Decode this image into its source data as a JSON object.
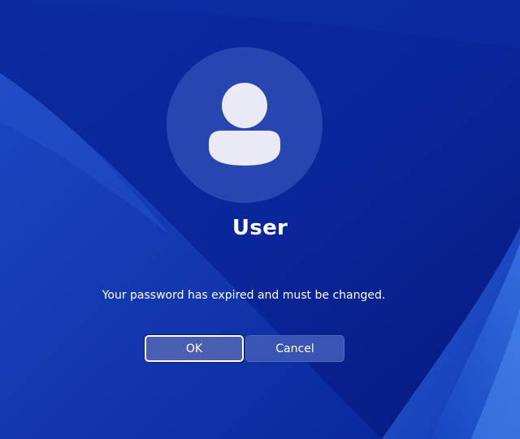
{
  "user": {
    "name": "User",
    "avatar_icon": "person-icon"
  },
  "dialog": {
    "message": "Your password has expired and must be changed.",
    "ok_label": "OK",
    "cancel_label": "Cancel"
  },
  "colors": {
    "background": "#0a2a9c",
    "button_ok": "#4a5fb2",
    "button_cancel": "#3a54b3",
    "text": "#ffffff"
  }
}
